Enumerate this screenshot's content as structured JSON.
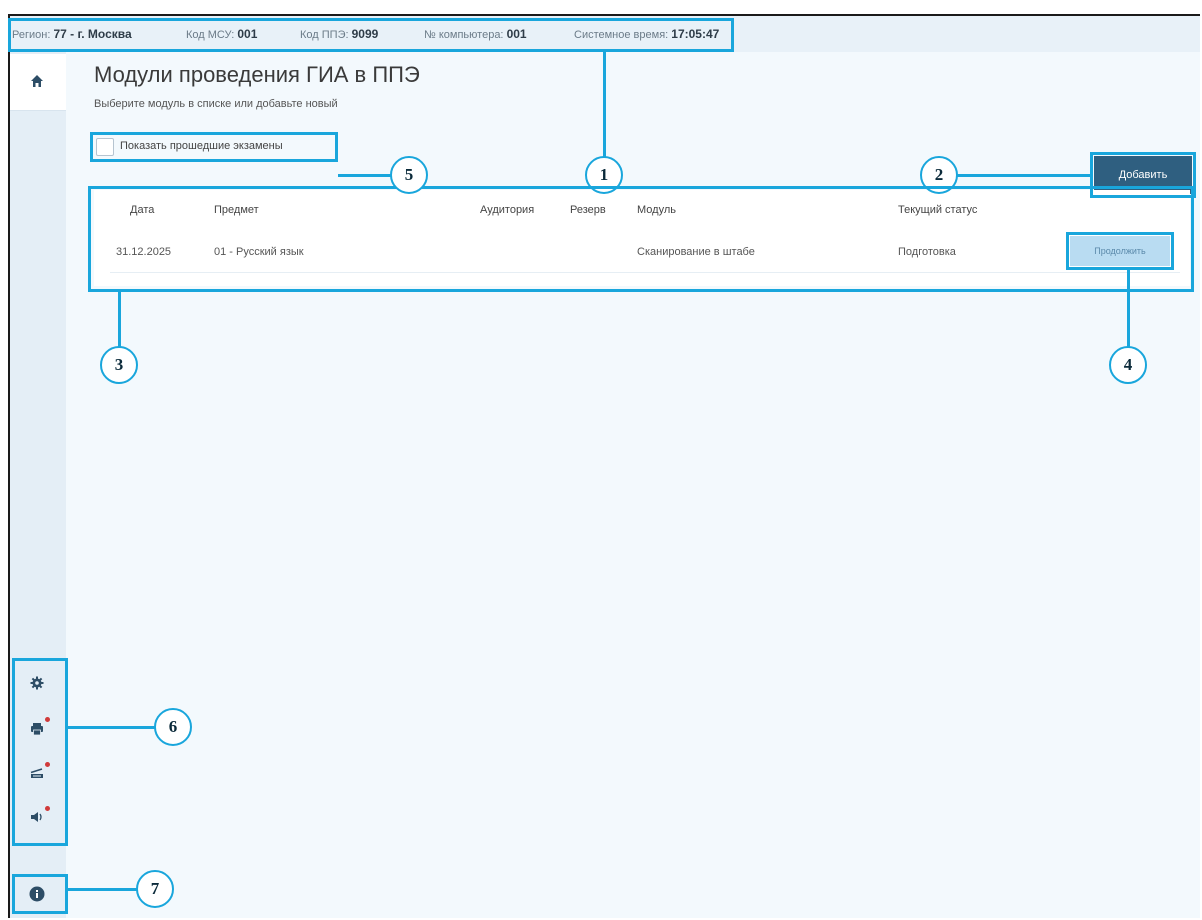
{
  "status_bar": {
    "region_label": "Регион:",
    "region_value": "77 - г. Москва",
    "msu_label": "Код МСУ:",
    "msu_value": "001",
    "ppe_label": "Код ППЭ:",
    "ppe_value": "9099",
    "computer_label": "№ компьютера:",
    "computer_value": "001",
    "time_label": "Системное время:",
    "time_value": "17:05:47"
  },
  "page": {
    "title": "Модули проведения ГИА в ППЭ",
    "subtitle": "Выберите модуль в списке или добавьте новый",
    "show_past_label": "Показать прошедшие экзамены",
    "add_button": "Добавить"
  },
  "table": {
    "headers": [
      "Дата",
      "Предмет",
      "Аудитория",
      "Резерв",
      "Модуль",
      "Текущий статус"
    ],
    "rows": [
      {
        "date": "31.12.2025",
        "subject": "01 - Русский язык",
        "auditorium": "",
        "reserve": "",
        "module": "Сканирование в штабе",
        "status": "Подготовка",
        "action": "Продолжить"
      }
    ]
  },
  "sidebar": {
    "top_icons": [
      "home-icon"
    ],
    "bottom_icons": [
      "gear-icon",
      "printer-icon",
      "scanner-icon",
      "sound-icon"
    ],
    "info_icon": "info-icon"
  },
  "callouts": [
    "1",
    "2",
    "3",
    "4",
    "5",
    "6",
    "7"
  ],
  "colors": {
    "accent": "#19a6dc",
    "primary_button": "#2f5f80",
    "secondary_button": "#b9dcf2",
    "background": "#f3f9fd",
    "alert_dot": "#d03a3a"
  }
}
